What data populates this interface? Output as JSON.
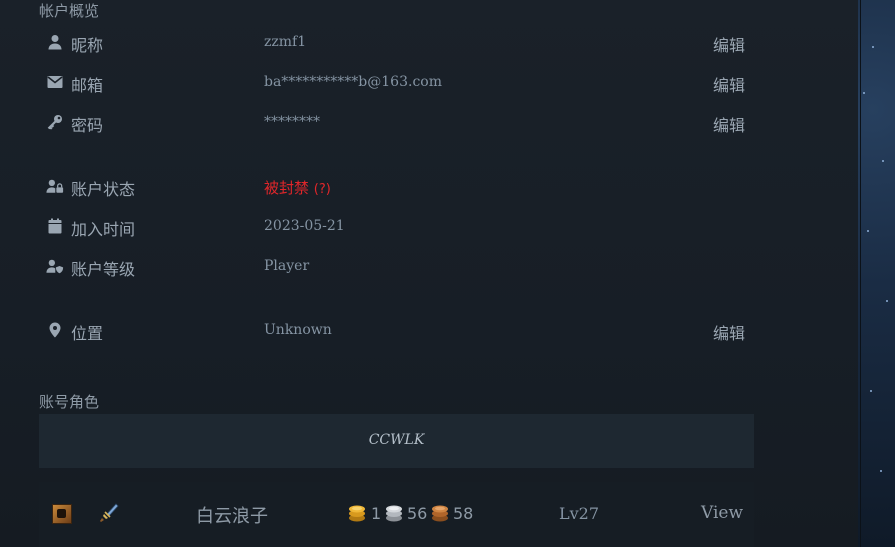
{
  "account": {
    "section_title": "帐户概览",
    "rows": [
      {
        "label": "昵称",
        "value": "zzmf1",
        "edit": "编辑"
      },
      {
        "label": "邮箱",
        "value": "ba***********b@163.com",
        "edit": "编辑"
      },
      {
        "label": "密码",
        "value": "********",
        "edit": "编辑"
      },
      {
        "label": "账户状态",
        "value": "被封禁",
        "help": "(?)"
      },
      {
        "label": "加入时间",
        "value": "2023-05-21"
      },
      {
        "label": "账户等级",
        "value": "Player"
      },
      {
        "label": "位置",
        "value": "Unknown",
        "edit": "编辑"
      }
    ]
  },
  "characters": {
    "section_title": "账号角色",
    "realm": "CCWLK",
    "list": [
      {
        "name": "白云浪子",
        "gold": "1",
        "silver": "56",
        "copper": "58",
        "level": "Lv27",
        "view": "View",
        "race_icon": "race-icon",
        "class_icon": "class-icon"
      }
    ]
  },
  "colors": {
    "background": "#1a2129",
    "text": "#9aa6b2",
    "value": "#8594a3",
    "banned": "#e0262a",
    "gold": "#e0a92a",
    "silver": "#c9ced4",
    "copper": "#c67a3c"
  }
}
